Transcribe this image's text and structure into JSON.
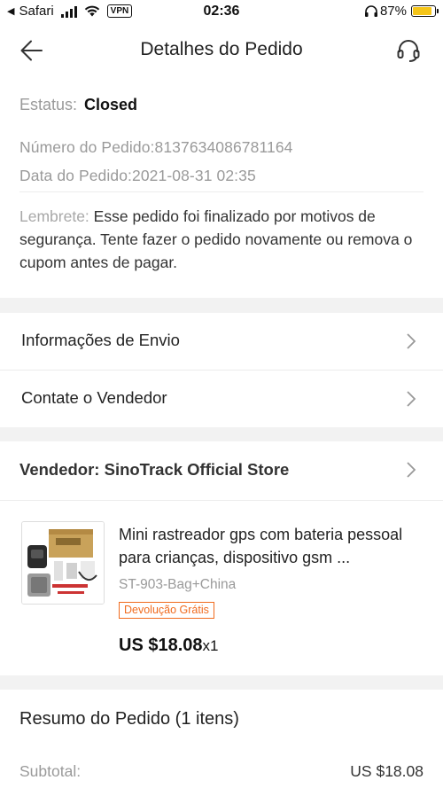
{
  "status_bar": {
    "carrier": "Safari",
    "vpn": "VPN",
    "time": "02:36",
    "battery": "87%",
    "battery_level": 0.87
  },
  "header": {
    "title": "Detalhes do Pedido"
  },
  "order": {
    "status_label": "Estatus:",
    "status_value": "Closed",
    "number_line": "Número do Pedido:8137634086781164",
    "date_line": "Data do Pedido:2021-08-31 02:35",
    "reminder_label": "Lembrete:",
    "reminder_text": "Esse pedido foi finalizado por motivos de segurança. Tente fazer o pedido novamente ou remova o cupom antes de pagar."
  },
  "menu": {
    "shipping": "Informações de Envio",
    "contact": "Contate o Vendedor"
  },
  "seller": {
    "label": "Vendedor: SinoTrack Official Store"
  },
  "product": {
    "title": "Mini rastreador gps com bateria pessoal para crianças, dispositivo gsm ...",
    "sku": "ST-903-Bag+China",
    "badge": "Devolução Grátis",
    "price": "US $18.08",
    "qty": "x1"
  },
  "summary": {
    "title": "Resumo do Pedido (1 itens)",
    "subtotal_label": "Subtotal:",
    "subtotal_value": "US $18.08"
  },
  "colors": {
    "accent": "#f06b1e",
    "battery": "#f5c518",
    "background": "#f2f2f2"
  }
}
